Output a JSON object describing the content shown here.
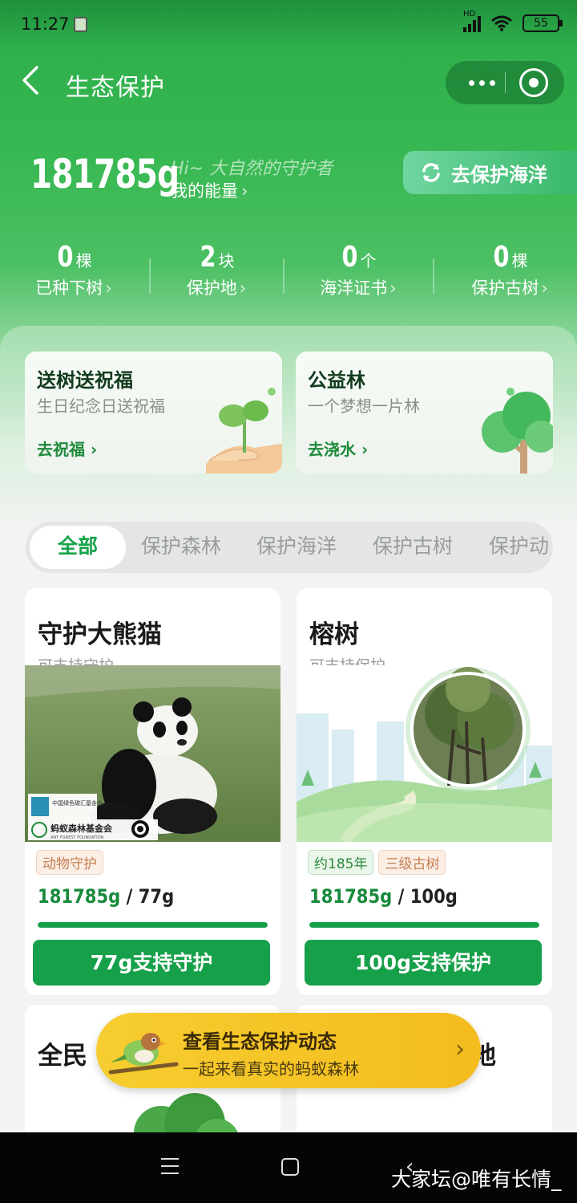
{
  "status_bar": {
    "time": "11:27",
    "battery": "55"
  },
  "nav": {
    "title": "生态保护"
  },
  "energy": {
    "value": "181785g",
    "greeting": "Hi~ 大自然的守护者",
    "label": "我的能量",
    "ocean_button": "去保护海洋"
  },
  "stats": [
    {
      "num": "0",
      "unit": "棵",
      "label": "已种下树"
    },
    {
      "num": "2",
      "unit": "块",
      "label": "保护地"
    },
    {
      "num": "0",
      "unit": "个",
      "label": "海洋证书"
    },
    {
      "num": "0",
      "unit": "棵",
      "label": "保护古树"
    }
  ],
  "promos": [
    {
      "title": "送树送祝福",
      "subtitle": "生日纪念日送祝福",
      "link": "去祝福"
    },
    {
      "title": "公益林",
      "subtitle": "一个梦想一片林",
      "link": "去浇水"
    }
  ],
  "tabs": [
    "全部",
    "保护森林",
    "保护海洋",
    "保护古树",
    "保护动"
  ],
  "cards": [
    {
      "title": "守护大熊猫",
      "subtitle": "可支持守护",
      "tags": [
        "动物守护"
      ],
      "have": "181785g",
      "need": "/ 77g",
      "progress": 1.0,
      "button": "77g支持守护",
      "logo_text": "蚂蚁森林基金会",
      "logo_sub": "ANT FOREST FOUNDATION",
      "cgcf_text": "中国绿色碳汇基金会"
    },
    {
      "title": "榕树",
      "subtitle": "可支持保护",
      "tags": [
        "约185年",
        "三级古树"
      ],
      "have": "181785g",
      "need": "/ 100g",
      "progress": 1.0,
      "button": "100g支持保护"
    }
  ],
  "cards_row2": [
    {
      "title": "全民"
    },
    {
      "title": "地"
    }
  ],
  "banner": {
    "title": "查看生态保护动态",
    "subtitle": "一起来看真实的蚂蚁森林"
  },
  "watermark": "大家坛@唯有长情_",
  "colors": {
    "primary_green": "#17a04a",
    "hero_green": "#2fb04c",
    "banner_yellow": "#f6cd30"
  }
}
